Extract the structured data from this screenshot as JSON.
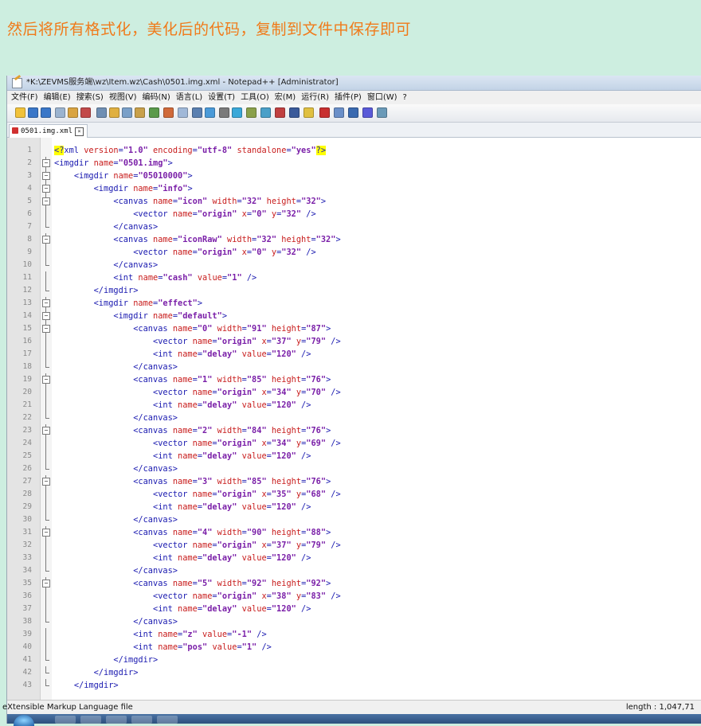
{
  "caption": "然后将所有格式化，美化后的代码，复制到文件中保存即可",
  "window": {
    "title": "*K:\\ZEVMS服务端\\wz\\Item.wz\\Cash\\0501.img.xml - Notepad++ [Administrator]",
    "icon": "notepad-plus-plus-icon"
  },
  "menu": [
    "文件(F)",
    "编辑(E)",
    "搜索(S)",
    "视图(V)",
    "编码(N)",
    "语言(L)",
    "设置(T)",
    "工具(O)",
    "宏(M)",
    "运行(R)",
    "插件(P)",
    "窗口(W)",
    "?"
  ],
  "tab": {
    "label": "0501.img.xml",
    "icon": "unsaved-file-icon"
  },
  "lines": [
    {
      "n": "1",
      "fold": "",
      "html": "<span class='t-pi'>&lt;?</span><span class='t-tag'>xml</span> <span class='t-attr'>version</span><span class='t-eq'>=</span><span class='t-val'>\"1.0\"</span> <span class='t-attr'>encoding</span><span class='t-eq'>=</span><span class='t-val'>\"utf-8\"</span> <span class='t-attr'>standalone</span><span class='t-eq'>=</span><span class='t-val'>\"yes\"</span><span class='t-pi'>?&gt;</span>"
    },
    {
      "n": "2",
      "fold": "box",
      "html": "<span class='t-br'>&lt;imgdir</span> <span class='t-attr'>name</span><span class='t-eq'>=</span><span class='t-val'>\"0501.img\"</span><span class='t-br'>&gt;</span>"
    },
    {
      "n": "3",
      "fold": "box",
      "html": "    <span class='t-br'>&lt;imgdir</span> <span class='t-attr'>name</span><span class='t-eq'>=</span><span class='t-val'>\"05010000\"</span><span class='t-br'>&gt;</span>"
    },
    {
      "n": "4",
      "fold": "box",
      "html": "        <span class='t-br'>&lt;imgdir</span> <span class='t-attr'>name</span><span class='t-eq'>=</span><span class='t-val'>\"info\"</span><span class='t-br'>&gt;</span>"
    },
    {
      "n": "5",
      "fold": "box",
      "html": "            <span class='t-br'>&lt;canvas</span> <span class='t-attr'>name</span><span class='t-eq'>=</span><span class='t-val'>\"icon\"</span> <span class='t-attr'>width</span><span class='t-eq'>=</span><span class='t-val'>\"32\"</span> <span class='t-attr'>height</span><span class='t-eq'>=</span><span class='t-val'>\"32\"</span><span class='t-br'>&gt;</span>"
    },
    {
      "n": "6",
      "fold": "v",
      "html": "                <span class='t-br'>&lt;vector</span> <span class='t-attr'>name</span><span class='t-eq'>=</span><span class='t-val'>\"origin\"</span> <span class='t-attr'>x</span><span class='t-eq'>=</span><span class='t-val'>\"0\"</span> <span class='t-attr'>y</span><span class='t-eq'>=</span><span class='t-val'>\"32\"</span> <span class='t-br'>/&gt;</span>"
    },
    {
      "n": "7",
      "fold": "end",
      "html": "            <span class='t-br'>&lt;/canvas&gt;</span>"
    },
    {
      "n": "8",
      "fold": "box",
      "html": "            <span class='t-br'>&lt;canvas</span> <span class='t-attr'>name</span><span class='t-eq'>=</span><span class='t-val'>\"iconRaw\"</span> <span class='t-attr'>width</span><span class='t-eq'>=</span><span class='t-val'>\"32\"</span> <span class='t-attr'>height</span><span class='t-eq'>=</span><span class='t-val'>\"32\"</span><span class='t-br'>&gt;</span>"
    },
    {
      "n": "9",
      "fold": "v",
      "html": "                <span class='t-br'>&lt;vector</span> <span class='t-attr'>name</span><span class='t-eq'>=</span><span class='t-val'>\"origin\"</span> <span class='t-attr'>x</span><span class='t-eq'>=</span><span class='t-val'>\"0\"</span> <span class='t-attr'>y</span><span class='t-eq'>=</span><span class='t-val'>\"32\"</span> <span class='t-br'>/&gt;</span>"
    },
    {
      "n": "10",
      "fold": "end",
      "html": "            <span class='t-br'>&lt;/canvas&gt;</span>"
    },
    {
      "n": "11",
      "fold": "v",
      "html": "            <span class='t-br'>&lt;int</span> <span class='t-attr'>name</span><span class='t-eq'>=</span><span class='t-val'>\"cash\"</span> <span class='t-attr'>value</span><span class='t-eq'>=</span><span class='t-val'>\"1\"</span> <span class='t-br'>/&gt;</span>"
    },
    {
      "n": "12",
      "fold": "end",
      "html": "        <span class='t-br'>&lt;/imgdir&gt;</span>"
    },
    {
      "n": "13",
      "fold": "box",
      "html": "        <span class='t-br'>&lt;imgdir</span> <span class='t-attr'>name</span><span class='t-eq'>=</span><span class='t-val'>\"effect\"</span><span class='t-br'>&gt;</span>"
    },
    {
      "n": "14",
      "fold": "box",
      "html": "            <span class='t-br'>&lt;imgdir</span> <span class='t-attr'>name</span><span class='t-eq'>=</span><span class='t-val'>\"default\"</span><span class='t-br'>&gt;</span>"
    },
    {
      "n": "15",
      "fold": "box",
      "html": "                <span class='t-br'>&lt;canvas</span> <span class='t-attr'>name</span><span class='t-eq'>=</span><span class='t-val'>\"0\"</span> <span class='t-attr'>width</span><span class='t-eq'>=</span><span class='t-val'>\"91\"</span> <span class='t-attr'>height</span><span class='t-eq'>=</span><span class='t-val'>\"87\"</span><span class='t-br'>&gt;</span>"
    },
    {
      "n": "16",
      "fold": "v",
      "html": "                    <span class='t-br'>&lt;vector</span> <span class='t-attr'>name</span><span class='t-eq'>=</span><span class='t-val'>\"origin\"</span> <span class='t-attr'>x</span><span class='t-eq'>=</span><span class='t-val'>\"37\"</span> <span class='t-attr'>y</span><span class='t-eq'>=</span><span class='t-val'>\"79\"</span> <span class='t-br'>/&gt;</span>"
    },
    {
      "n": "17",
      "fold": "v",
      "html": "                    <span class='t-br'>&lt;int</span> <span class='t-attr'>name</span><span class='t-eq'>=</span><span class='t-val'>\"delay\"</span> <span class='t-attr'>value</span><span class='t-eq'>=</span><span class='t-val'>\"120\"</span> <span class='t-br'>/&gt;</span>"
    },
    {
      "n": "18",
      "fold": "end",
      "html": "                <span class='t-br'>&lt;/canvas&gt;</span>"
    },
    {
      "n": "19",
      "fold": "box",
      "html": "                <span class='t-br'>&lt;canvas</span> <span class='t-attr'>name</span><span class='t-eq'>=</span><span class='t-val'>\"1\"</span> <span class='t-attr'>width</span><span class='t-eq'>=</span><span class='t-val'>\"85\"</span> <span class='t-attr'>height</span><span class='t-eq'>=</span><span class='t-val'>\"76\"</span><span class='t-br'>&gt;</span>"
    },
    {
      "n": "20",
      "fold": "v",
      "html": "                    <span class='t-br'>&lt;vector</span> <span class='t-attr'>name</span><span class='t-eq'>=</span><span class='t-val'>\"origin\"</span> <span class='t-attr'>x</span><span class='t-eq'>=</span><span class='t-val'>\"34\"</span> <span class='t-attr'>y</span><span class='t-eq'>=</span><span class='t-val'>\"70\"</span> <span class='t-br'>/&gt;</span>"
    },
    {
      "n": "21",
      "fold": "v",
      "html": "                    <span class='t-br'>&lt;int</span> <span class='t-attr'>name</span><span class='t-eq'>=</span><span class='t-val'>\"delay\"</span> <span class='t-attr'>value</span><span class='t-eq'>=</span><span class='t-val'>\"120\"</span> <span class='t-br'>/&gt;</span>"
    },
    {
      "n": "22",
      "fold": "end",
      "html": "                <span class='t-br'>&lt;/canvas&gt;</span>"
    },
    {
      "n": "23",
      "fold": "box",
      "html": "                <span class='t-br'>&lt;canvas</span> <span class='t-attr'>name</span><span class='t-eq'>=</span><span class='t-val'>\"2\"</span> <span class='t-attr'>width</span><span class='t-eq'>=</span><span class='t-val'>\"84\"</span> <span class='t-attr'>height</span><span class='t-eq'>=</span><span class='t-val'>\"76\"</span><span class='t-br'>&gt;</span>"
    },
    {
      "n": "24",
      "fold": "v",
      "html": "                    <span class='t-br'>&lt;vector</span> <span class='t-attr'>name</span><span class='t-eq'>=</span><span class='t-val'>\"origin\"</span> <span class='t-attr'>x</span><span class='t-eq'>=</span><span class='t-val'>\"34\"</span> <span class='t-attr'>y</span><span class='t-eq'>=</span><span class='t-val'>\"69\"</span> <span class='t-br'>/&gt;</span>"
    },
    {
      "n": "25",
      "fold": "v",
      "html": "                    <span class='t-br'>&lt;int</span> <span class='t-attr'>name</span><span class='t-eq'>=</span><span class='t-val'>\"delay\"</span> <span class='t-attr'>value</span><span class='t-eq'>=</span><span class='t-val'>\"120\"</span> <span class='t-br'>/&gt;</span>"
    },
    {
      "n": "26",
      "fold": "end",
      "html": "                <span class='t-br'>&lt;/canvas&gt;</span>"
    },
    {
      "n": "27",
      "fold": "box",
      "html": "                <span class='t-br'>&lt;canvas</span> <span class='t-attr'>name</span><span class='t-eq'>=</span><span class='t-val'>\"3\"</span> <span class='t-attr'>width</span><span class='t-eq'>=</span><span class='t-val'>\"85\"</span> <span class='t-attr'>height</span><span class='t-eq'>=</span><span class='t-val'>\"76\"</span><span class='t-br'>&gt;</span>"
    },
    {
      "n": "28",
      "fold": "v",
      "html": "                    <span class='t-br'>&lt;vector</span> <span class='t-attr'>name</span><span class='t-eq'>=</span><span class='t-val'>\"origin\"</span> <span class='t-attr'>x</span><span class='t-eq'>=</span><span class='t-val'>\"35\"</span> <span class='t-attr'>y</span><span class='t-eq'>=</span><span class='t-val'>\"68\"</span> <span class='t-br'>/&gt;</span>"
    },
    {
      "n": "29",
      "fold": "v",
      "html": "                    <span class='t-br'>&lt;int</span> <span class='t-attr'>name</span><span class='t-eq'>=</span><span class='t-val'>\"delay\"</span> <span class='t-attr'>value</span><span class='t-eq'>=</span><span class='t-val'>\"120\"</span> <span class='t-br'>/&gt;</span>"
    },
    {
      "n": "30",
      "fold": "end",
      "html": "                <span class='t-br'>&lt;/canvas&gt;</span>"
    },
    {
      "n": "31",
      "fold": "box",
      "html": "                <span class='t-br'>&lt;canvas</span> <span class='t-attr'>name</span><span class='t-eq'>=</span><span class='t-val'>\"4\"</span> <span class='t-attr'>width</span><span class='t-eq'>=</span><span class='t-val'>\"90\"</span> <span class='t-attr'>height</span><span class='t-eq'>=</span><span class='t-val'>\"88\"</span><span class='t-br'>&gt;</span>"
    },
    {
      "n": "32",
      "fold": "v",
      "html": "                    <span class='t-br'>&lt;vector</span> <span class='t-attr'>name</span><span class='t-eq'>=</span><span class='t-val'>\"origin\"</span> <span class='t-attr'>x</span><span class='t-eq'>=</span><span class='t-val'>\"37\"</span> <span class='t-attr'>y</span><span class='t-eq'>=</span><span class='t-val'>\"79\"</span> <span class='t-br'>/&gt;</span>"
    },
    {
      "n": "33",
      "fold": "v",
      "html": "                    <span class='t-br'>&lt;int</span> <span class='t-attr'>name</span><span class='t-eq'>=</span><span class='t-val'>\"delay\"</span> <span class='t-attr'>value</span><span class='t-eq'>=</span><span class='t-val'>\"120\"</span> <span class='t-br'>/&gt;</span>"
    },
    {
      "n": "34",
      "fold": "end",
      "html": "                <span class='t-br'>&lt;/canvas&gt;</span>"
    },
    {
      "n": "35",
      "fold": "box",
      "html": "                <span class='t-br'>&lt;canvas</span> <span class='t-attr'>name</span><span class='t-eq'>=</span><span class='t-val'>\"5\"</span> <span class='t-attr'>width</span><span class='t-eq'>=</span><span class='t-val'>\"92\"</span> <span class='t-attr'>height</span><span class='t-eq'>=</span><span class='t-val'>\"92\"</span><span class='t-br'>&gt;</span>"
    },
    {
      "n": "36",
      "fold": "v",
      "html": "                    <span class='t-br'>&lt;vector</span> <span class='t-attr'>name</span><span class='t-eq'>=</span><span class='t-val'>\"origin\"</span> <span class='t-attr'>x</span><span class='t-eq'>=</span><span class='t-val'>\"38\"</span> <span class='t-attr'>y</span><span class='t-eq'>=</span><span class='t-val'>\"83\"</span> <span class='t-br'>/&gt;</span>"
    },
    {
      "n": "37",
      "fold": "v",
      "html": "                    <span class='t-br'>&lt;int</span> <span class='t-attr'>name</span><span class='t-eq'>=</span><span class='t-val'>\"delay\"</span> <span class='t-attr'>value</span><span class='t-eq'>=</span><span class='t-val'>\"120\"</span> <span class='t-br'>/&gt;</span>"
    },
    {
      "n": "38",
      "fold": "end",
      "html": "                <span class='t-br'>&lt;/canvas&gt;</span>"
    },
    {
      "n": "39",
      "fold": "v",
      "html": "                <span class='t-br'>&lt;int</span> <span class='t-attr'>name</span><span class='t-eq'>=</span><span class='t-val'>\"z\"</span> <span class='t-attr'>value</span><span class='t-eq'>=</span><span class='t-val'>\"-1\"</span> <span class='t-br'>/&gt;</span>"
    },
    {
      "n": "40",
      "fold": "v",
      "html": "                <span class='t-br'>&lt;int</span> <span class='t-attr'>name</span><span class='t-eq'>=</span><span class='t-val'>\"pos\"</span> <span class='t-attr'>value</span><span class='t-eq'>=</span><span class='t-val'>\"1\"</span> <span class='t-br'>/&gt;</span>"
    },
    {
      "n": "41",
      "fold": "end",
      "html": "            <span class='t-br'>&lt;/imgdir&gt;</span>"
    },
    {
      "n": "42",
      "fold": "end",
      "html": "        <span class='t-br'>&lt;/imgdir&gt;</span>"
    },
    {
      "n": "43",
      "fold": "end",
      "html": "    <span class='t-br'>&lt;/imgdir&gt;</span>"
    }
  ],
  "status": {
    "filetype": "eXtensible Markup Language file",
    "length": "length : 1,047,71"
  },
  "colors": {
    "caption": "#f07a1a",
    "background": "#cdeee0",
    "tag": "#1a1ab0",
    "attribute": "#c81d1d",
    "value": "#7a1fa8",
    "pi_highlight": "#ffff00"
  }
}
